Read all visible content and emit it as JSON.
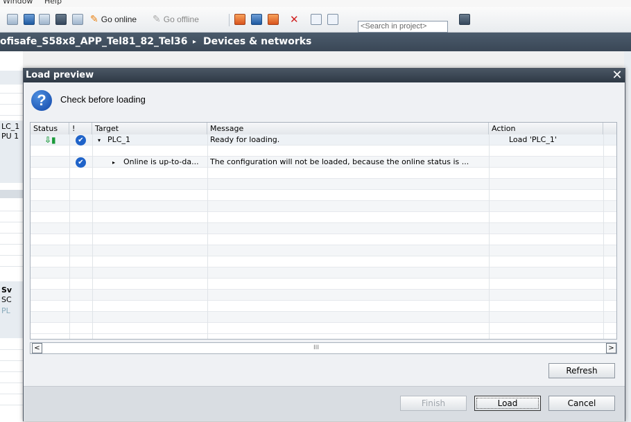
{
  "app": {
    "menu": [
      "Window",
      "Help"
    ],
    "toolbar": {
      "go_online": "Go online",
      "go_offline": "Go offline",
      "search_placeholder": "<Search in project>"
    },
    "breadcrumb": {
      "project": "ofisafe_S58x8_APP_Tel81_82_Tel36",
      "separator": "▸",
      "section": "Devices & networks"
    },
    "left_pane": {
      "labels": [
        "LC_1",
        "PU 1",
        "Sv",
        "SC",
        "PL"
      ]
    }
  },
  "dialog": {
    "title": "Load preview",
    "close": "✕",
    "info_icon": "?",
    "heading": "Check before loading",
    "table": {
      "columns": [
        "Status",
        "!",
        "Target",
        "Message",
        "Action"
      ],
      "rows": [
        {
          "status_icon": "download-green-icon",
          "check": "✔",
          "expand": "▾",
          "target": "PLC_1",
          "message": "Ready for loading.",
          "action": "Load 'PLC_1'"
        },
        {
          "status_icon": "",
          "check": "",
          "expand": "",
          "target": "",
          "message": "",
          "action": ""
        },
        {
          "status_icon": "",
          "check": "✔",
          "expand": "▸",
          "target": "Online is up-to-da...",
          "message": "The configuration will not be loaded, because the online status is ...",
          "action": ""
        }
      ]
    },
    "scrollbar": {
      "left": "<",
      "thumb": "III",
      "right": ">"
    },
    "buttons": {
      "refresh": "Refresh",
      "finish": "Finish",
      "load": "Load",
      "cancel": "Cancel"
    }
  }
}
